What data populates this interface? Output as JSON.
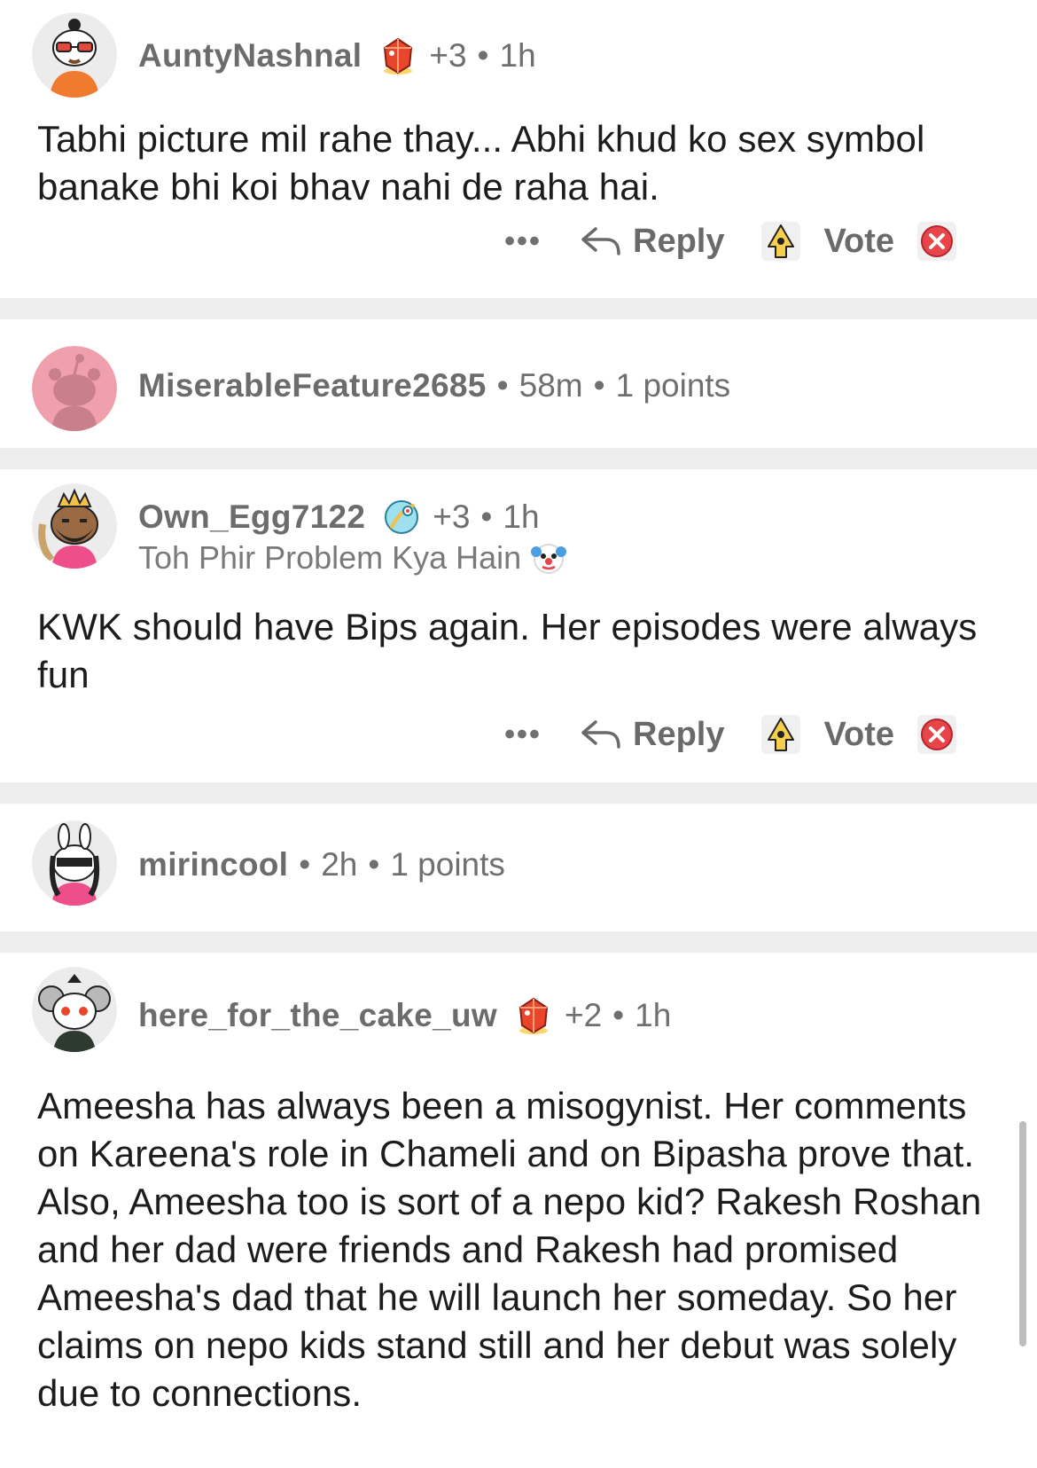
{
  "comments": [
    {
      "username": "AuntyNashnal",
      "award_icon": "ruby-award-icon",
      "score": "+3",
      "time": "1h",
      "body": "Tabhi picture mil rahe thay... Abhi khud ko sex symbol banake bhi koi bhav nahi de raha hai.",
      "actions": {
        "more": "•••",
        "reply": "Reply",
        "vote": "Vote"
      }
    },
    {
      "username": "MiserableFeature2685",
      "time": "58m",
      "points": "1 points"
    },
    {
      "username": "Own_Egg7122",
      "award_icon": "aqua-award-icon",
      "score": "+3",
      "time": "1h",
      "flair": "Toh Phir Problem Kya Hain",
      "flair_icon": "clown-emoji-icon",
      "body": "KWK should have Bips again. Her episodes were always fun",
      "actions": {
        "more": "•••",
        "reply": "Reply",
        "vote": "Vote"
      }
    },
    {
      "username": "mirincool",
      "time": "2h",
      "points": "1 points"
    },
    {
      "username": "here_for_the_cake_uw",
      "award_icon": "ruby-award-icon",
      "score": "+2",
      "time": "1h",
      "body": "Ameesha has always been a misogynist. Her comments on Kareena's role in Chameli and on Bipasha prove that. Also, Ameesha too is sort of a nepo kid? Rakesh Roshan and her dad were friends and Rakesh had promised Ameesha's dad that he will launch her someday. So her claims on nepo kids stand still and her debut was solely due to connections."
    }
  ],
  "separator": "•",
  "colors": {
    "background": "#ffffff",
    "separator": "#ededed",
    "text": "#1c1c1c",
    "meta": "#6f6f6f",
    "downvote": "#e8454b",
    "upvote": "#f2c233"
  }
}
